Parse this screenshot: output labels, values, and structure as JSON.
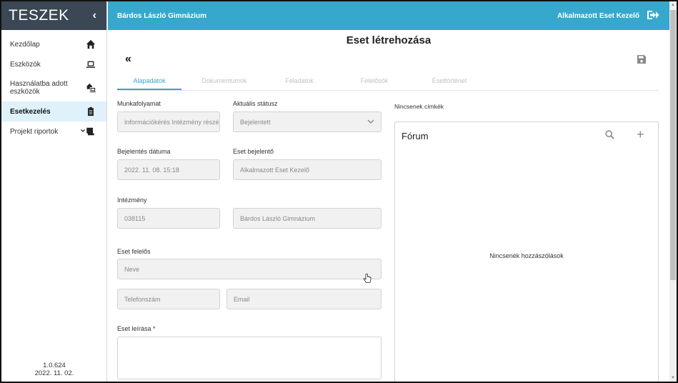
{
  "app": {
    "brand": "TESZEK",
    "collapse_glyph": "‹"
  },
  "sidebar": {
    "items": [
      {
        "label": "Kezdőlap",
        "icon": "home-icon"
      },
      {
        "label": "Eszközök",
        "icon": "laptop-icon"
      },
      {
        "label": "Használatba adott eszközök",
        "icon": "home-laptop-icon"
      },
      {
        "label": "Esetkezelés",
        "icon": "clipboard-icon",
        "active": true
      },
      {
        "label": "Projekt riportok",
        "icon": "report-icon"
      }
    ],
    "version": "1.0.624",
    "version_date": "2022. 11. 02."
  },
  "topbar": {
    "school": "Bárdos László Gimnázium",
    "user": "Alkalmazott Eset Kezelő"
  },
  "page": {
    "title": "Eset létrehozása"
  },
  "tabs": [
    {
      "label": "Alapadatok",
      "active": true
    },
    {
      "label": "Dokumentumok"
    },
    {
      "label": "Feladatok"
    },
    {
      "label": "Felelősök"
    },
    {
      "label": "Esettörténet"
    }
  ],
  "form": {
    "workflow": {
      "label": "Munkafolyamat",
      "value": "Információkérés Intézmény részé"
    },
    "status": {
      "label": "Aktuális státusz",
      "value": "Bejelentett"
    },
    "report_date": {
      "label": "Bejelentés dátuma",
      "value": "2022. 11. 08. 15:18"
    },
    "reporter": {
      "label": "Eset bejelentő",
      "value": "Alkalmazott Eset Kezelő"
    },
    "institution": {
      "label": "Intézmény",
      "code": "038115",
      "name": "Bárdos László Gimnázium"
    },
    "responsible": {
      "label": "Eset felelős",
      "name_placeholder": "Neve",
      "phone_placeholder": "Telefonszám",
      "email_placeholder": "Email"
    },
    "description": {
      "label": "Eset leírása *",
      "value": ""
    }
  },
  "tags": {
    "empty_text": "Nincsenek címkék"
  },
  "forum": {
    "title": "Fórum",
    "empty_text": "Nincsenek hozzászólások",
    "add_glyph": "+"
  },
  "colors": {
    "accent": "#36a8cc",
    "brand_bg": "#3b4754",
    "active_nav_bg": "#dff1fa"
  }
}
